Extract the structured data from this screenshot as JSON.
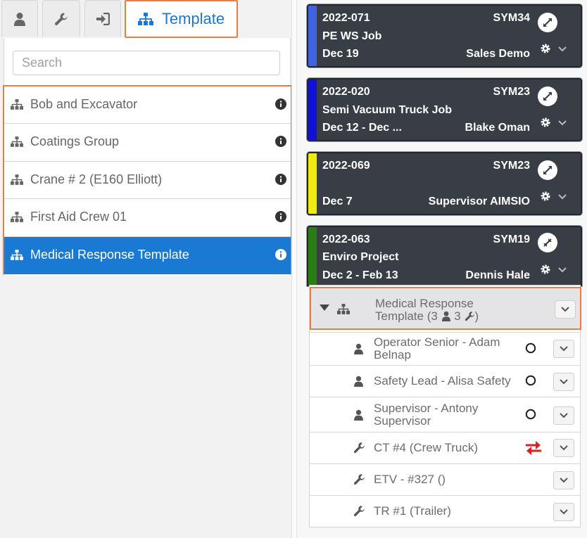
{
  "tabs": [
    {
      "icon": "user-icon"
    },
    {
      "icon": "wrench-icon"
    },
    {
      "icon": "sign-in-icon"
    },
    {
      "icon": "sitemap-icon",
      "label": "Template",
      "active": true
    }
  ],
  "search": {
    "placeholder": "Search"
  },
  "templates": [
    {
      "label": "Bob and Excavator"
    },
    {
      "label": "Coatings Group"
    },
    {
      "label": "Crane # 2 (E160 Elliott)"
    },
    {
      "label": "First Aid Crew 01"
    },
    {
      "label": "Medical Response Template",
      "selected": true
    }
  ],
  "jobs": [
    {
      "number": "2022-071",
      "code": "SYM34",
      "name": "PE WS Job",
      "dates": "Dec 19",
      "person": "Sales Demo",
      "color": "#3f63e3"
    },
    {
      "number": "2022-020",
      "code": "SYM23",
      "name": "Semi Vacuum Truck Job",
      "dates": "Dec 12 - Dec ...",
      "person": "Blake Oman",
      "color": "#1010d8"
    },
    {
      "number": "2022-069",
      "code": "SYM23",
      "name": "",
      "dates": "Dec 7",
      "person": "Supervisor AIMSIO",
      "color": "#f0eb0c"
    },
    {
      "number": "2022-063",
      "code": "SYM19",
      "name": "Enviro Project",
      "dates": "Dec 2 - Feb 13",
      "person": "Dennis Hale",
      "color": "#2a7d12"
    }
  ],
  "crew_group": {
    "name": "Medical Response",
    "name_line2": "Template (3",
    "people_count": "3",
    "close": ")",
    "members": [
      {
        "type": "person",
        "line1": "Operator Senior - Adam",
        "line2": "Belnap",
        "status": "circle"
      },
      {
        "type": "person",
        "line1": "Safety Lead - Alisa Safety",
        "line2": "",
        "status": "circle"
      },
      {
        "type": "person",
        "line1": "Supervisor - Antony",
        "line2": "Supervisor",
        "status": "circle"
      },
      {
        "type": "equipment",
        "line1": "CT #4 (Crew Truck)",
        "line2": "",
        "status": "swap"
      },
      {
        "type": "equipment",
        "line1": "ETV - #327 ()",
        "line2": "",
        "status": ""
      },
      {
        "type": "equipment",
        "line1": "TR #1 (Trailer)",
        "line2": "",
        "status": ""
      }
    ]
  },
  "colors": {
    "accent": "#1a7ad3",
    "highlight_border": "#ea7d45",
    "card_bg": "#383d46",
    "swap_icon": "#e02020"
  }
}
